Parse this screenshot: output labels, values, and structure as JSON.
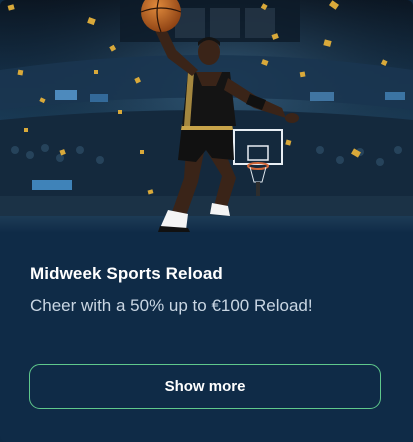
{
  "promo": {
    "title": "Midweek Sports Reload",
    "description": "Cheer with a 50% up to €100 Reload!",
    "cta_label": "Show more"
  },
  "colors": {
    "card_background": "#0f2b47",
    "button_border": "#5fc88c",
    "title_text": "#ffffff",
    "description_text": "#c9d6e3"
  },
  "image": {
    "subject": "basketball-player-dunking-in-arena"
  }
}
